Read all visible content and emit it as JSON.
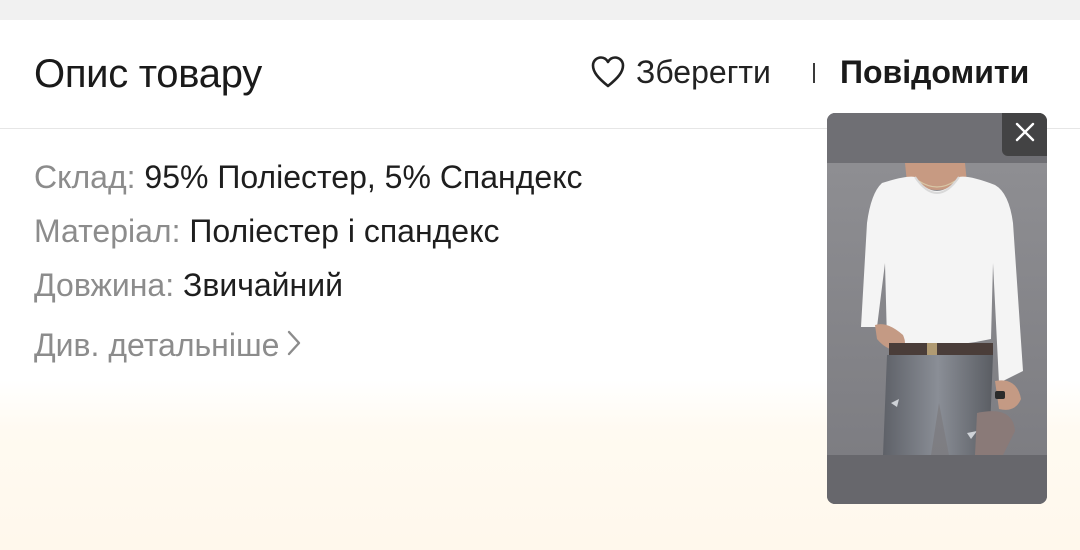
{
  "header": {
    "title": "Опис товару",
    "save_label": "Зберегти",
    "report_label": "Повідомити"
  },
  "description": {
    "rows": [
      {
        "key": "Склад:",
        "value": "95% Поліестер, 5% Спандекс"
      },
      {
        "key": "Матеріал:",
        "value": "Поліестер і спандекс"
      },
      {
        "key": "Довжина:",
        "value": "Звичайний"
      }
    ],
    "more_label": "Див. детальніше"
  },
  "icons": {
    "save": "heart-outline-icon",
    "more": "chevron-right-icon",
    "close": "close-icon"
  },
  "colors": {
    "text_primary": "#1a1a1a",
    "text_secondary": "#8c8c8c",
    "bottom_tint": "#fff8ec"
  }
}
